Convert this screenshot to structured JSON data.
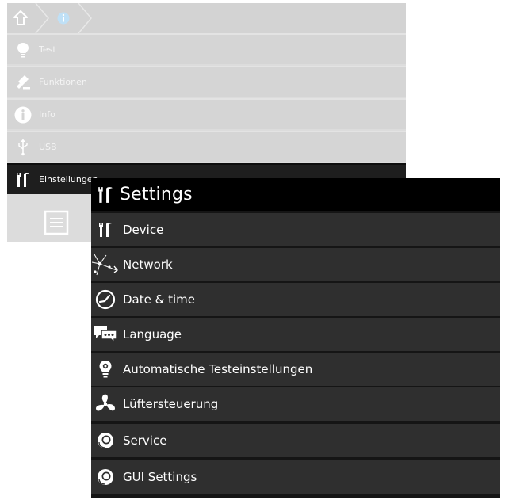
{
  "background_menu": {
    "breadcrumb": {
      "home_icon": "home-icon",
      "info_icon": "info-icon"
    },
    "items": [
      {
        "label": "Test",
        "icon": "lightbulb-icon"
      },
      {
        "label": "Funktionen",
        "icon": "functions-icon"
      },
      {
        "label": "Info",
        "icon": "info-icon"
      },
      {
        "label": "USB",
        "icon": "usb-icon"
      },
      {
        "label": "Einstellungen",
        "icon": "settings-tools-icon",
        "active": true
      }
    ],
    "footer_icon": "list-icon"
  },
  "settings": {
    "title": "Settings",
    "title_icon": "settings-tools-icon",
    "items": [
      {
        "label": "Device",
        "icon": "settings-tools-icon"
      },
      {
        "label": "Network",
        "icon": "network-icon"
      },
      {
        "label": "Date & time",
        "icon": "clock-icon"
      },
      {
        "label": "Language",
        "icon": "chat-bubbles-icon"
      },
      {
        "label": "Automatische Testeinstellungen",
        "icon": "lightbulb-gear-icon"
      },
      {
        "label": "Lüftersteuerung",
        "icon": "fan-icon"
      },
      {
        "label": "Service",
        "icon": "headset-icon"
      },
      {
        "label": "GUI Settings",
        "icon": "headset-icon"
      }
    ]
  },
  "colors": {
    "bg_panel": "#dcdcdc",
    "bg_active": "#1e1e1e",
    "settings_header": "#000000",
    "settings_item": "#2f2f2f",
    "text_light": "#ffffff"
  }
}
